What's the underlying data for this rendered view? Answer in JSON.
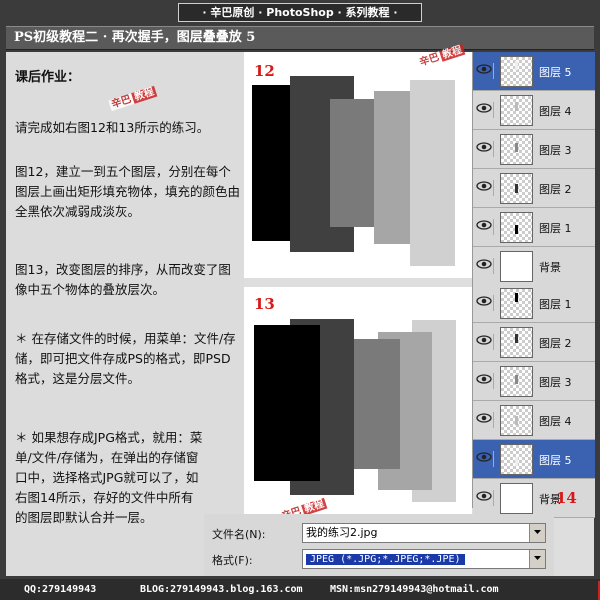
{
  "banner": "· 辛巴原创 · PhotoShop · 系列教程 ·",
  "title": "PS初级教程二 · 再次握手，图层叠叠放 5",
  "homework": {
    "heading": "课后作业：",
    "p1": "请完成如右图12和13所示的练习。",
    "p2": "图12，建立一到五个图层，分别在每个图层上画出矩形填充物体，填充的颜色由全黑依次减弱成淡灰。",
    "p3": "图13，改变图层的排序，从而改变了图像中五个物体的叠放层次。",
    "p4": "＊ 在存储文件的时候，用菜单：文件/存储，即可把文件存成PS的格式，即PSD格式，这是分层文件。",
    "p5": "＊ 如果想存成JPG格式，就用：菜单/文件/存储为，在弹出的存储窗口中，选择格式JPG就可以了，如右图14所示，存好的文件中所有的图层即默认合并一层。"
  },
  "stamp": {
    "a": "辛巴",
    "b": "教程"
  },
  "figures": {
    "f12": "12",
    "f13": "13",
    "f14": "14"
  },
  "layers12": [
    {
      "name": "图层 5",
      "selected": true,
      "thumb": "checker"
    },
    {
      "name": "图层 4",
      "selected": false,
      "thumb": "checker"
    },
    {
      "name": "图层 3",
      "selected": false,
      "thumb": "checker"
    },
    {
      "name": "图层 2",
      "selected": false,
      "thumb": "checker"
    },
    {
      "name": "图层 1",
      "selected": false,
      "thumb": "checker"
    },
    {
      "name": "背景",
      "selected": false,
      "thumb": "white"
    }
  ],
  "layers13": [
    {
      "name": "图层 1",
      "selected": false,
      "thumb": "checker"
    },
    {
      "name": "图层 2",
      "selected": false,
      "thumb": "checker"
    },
    {
      "name": "图层 3",
      "selected": false,
      "thumb": "checker"
    },
    {
      "name": "图层 4",
      "selected": false,
      "thumb": "checker"
    },
    {
      "name": "图层 5",
      "selected": true,
      "thumb": "checker"
    },
    {
      "name": "背景",
      "selected": false,
      "thumb": "white"
    }
  ],
  "dialog": {
    "filename_label": "文件名(N):",
    "filename_value": "我的练习2.jpg",
    "format_label": "格式(F):",
    "format_value": "JPEG (*.JPG;*.JPEG;*.JPE)"
  },
  "footer": {
    "qq": "QQ:279149943",
    "blog": "BLOG:279149943.blog.163.com",
    "msn": "MSN:msn279149943@hotmail.com"
  },
  "colors": {
    "black": "#000000",
    "dark": "#404040",
    "mid": "#7a7a7a",
    "light": "#a6a6a6",
    "pale": "#d0d0d0",
    "selected": "#3b61b1",
    "accent_red": "#d81818"
  }
}
